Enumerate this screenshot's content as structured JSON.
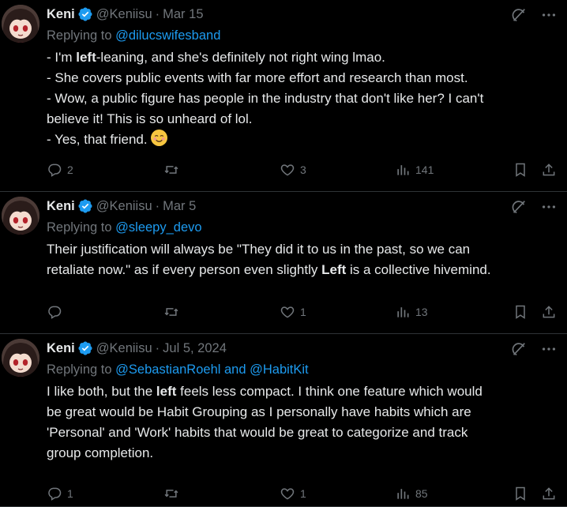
{
  "colors": {
    "background": "#000000",
    "text": "#e7e9ea",
    "muted": "#71767b",
    "link": "#1d9bf0",
    "divider": "#2f3336",
    "verified": "#1d9bf0"
  },
  "tweets": [
    {
      "name": "Keni",
      "handle": "@Keniisu",
      "sep": "·",
      "date": "Mar 15",
      "replying_label": "Replying to",
      "replying_to": "@dilucswifesband",
      "lines": [
        [
          "- I'm ",
          "left",
          "-leaning, and she's definitely not right wing lmao."
        ],
        [
          "- She covers public events with far more effort and research than most."
        ],
        [
          "- Wow, a public figure has people in the industry that don't like her? I can't"
        ],
        [
          "believe it! This is so unheard of lol."
        ],
        [
          "- Yes, that friend. "
        ]
      ],
      "emoji": "smiling-face-emoji",
      "replies": "2",
      "retweets": "",
      "likes": "3",
      "views": "141"
    },
    {
      "name": "Keni",
      "handle": "@Keniisu",
      "sep": "·",
      "date": "Mar 5",
      "replying_label": "Replying to",
      "replying_to": "@sleepy_devo",
      "lines": [
        [
          "Their justification will always be \"They did it to us in the past, so we can"
        ],
        [
          "retaliate now.\" as if every person even slightly ",
          "Left",
          " is a collective hivemind."
        ]
      ],
      "replies": "",
      "retweets": "",
      "likes": "1",
      "views": "13"
    },
    {
      "name": "Keni",
      "handle": "@Keniisu",
      "sep": "·",
      "date": "Jul 5, 2024",
      "replying_label": "Replying to",
      "replying_to": "@SebastianRoehl and @HabitKit",
      "lines": [
        [
          "I like both, but the ",
          "left",
          " feels less compact. I think one feature which would"
        ],
        [
          "be great would be Habit Grouping as I personally have habits which are"
        ],
        [
          "'Personal' and 'Work' habits that would be great to categorize and track"
        ],
        [
          "group completion."
        ]
      ],
      "replies": "1",
      "retweets": "",
      "likes": "1",
      "views": "85"
    }
  ],
  "icons": {
    "verified": "verified-badge-icon",
    "grok": "grok-icon",
    "more": "more-icon",
    "reply": "reply-icon",
    "retweet": "retweet-icon",
    "like": "like-icon",
    "views": "views-icon",
    "bookmark": "bookmark-icon",
    "share": "share-icon"
  }
}
